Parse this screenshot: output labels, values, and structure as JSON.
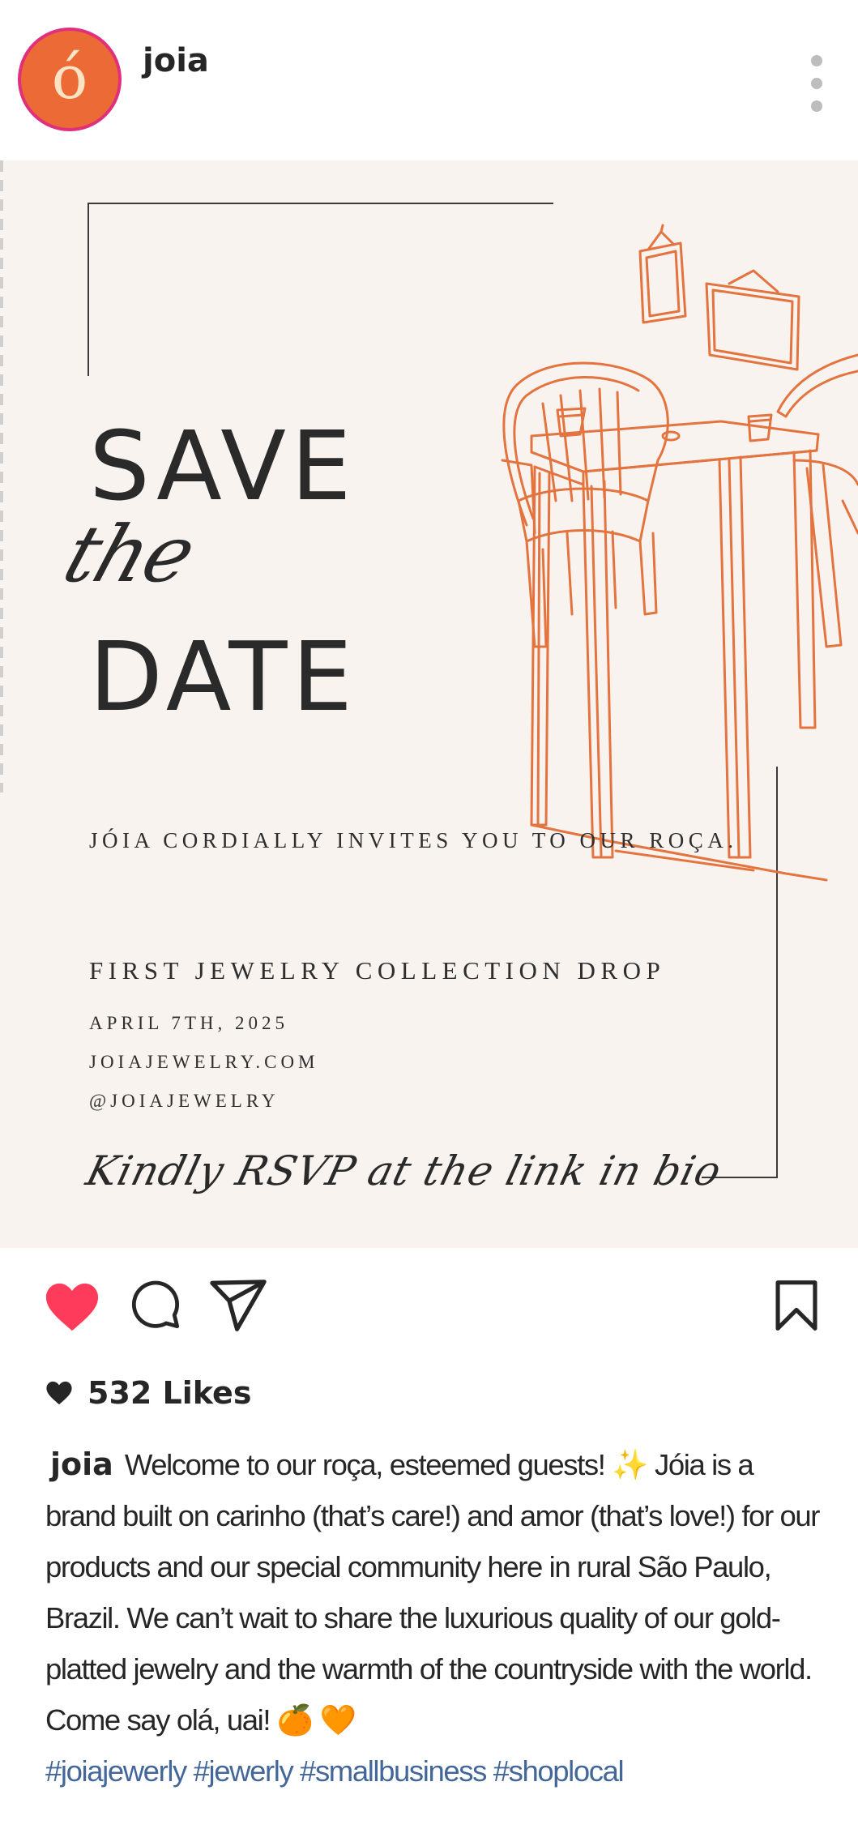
{
  "header": {
    "avatar_glyph": "ó",
    "username": "joia",
    "more_icon": "more-vertical-icon"
  },
  "post": {
    "headline_top": "SAVE",
    "headline_script": "the",
    "headline_bottom": "DATE",
    "invite_line": "JÓIA CORDIALLY INVITES YOU TO OUR ROÇA.",
    "collection_line": "FIRST JEWELRY COLLECTION DROP",
    "date_line": "APRIL 7TH, 2025",
    "website_line": "JOIAJEWELRY.COM",
    "handle_line": "@JOIAJEWELRY",
    "rsvp_line": "Kindly RSVP at the link in bio",
    "illustration_color": "#e4743f",
    "background_color": "#f8f3ef"
  },
  "actions": {
    "like_icon": "heart-filled-icon",
    "like_color": "#ff3b5c",
    "comment_icon": "comment-icon",
    "share_icon": "paper-plane-icon",
    "save_icon": "bookmark-icon"
  },
  "likes": {
    "label": "532 Likes"
  },
  "caption": {
    "username": "joia",
    "text": "Welcome to our roça, esteemed guests! ✨ Jóia is a brand built on carinho (that’s care!) and amor (that’s love!) for our products and our special community here in rural São Paulo, Brazil. We can’t wait to share the luxurious quality of our gold-platted jewelry and the warmth of the countryside with the world. Come say olá, uai! 🍊 🧡",
    "hashtags": "#joiajewerly #jewerly #smallbusiness #shoplocal",
    "hashtag_color": "#44679a"
  }
}
